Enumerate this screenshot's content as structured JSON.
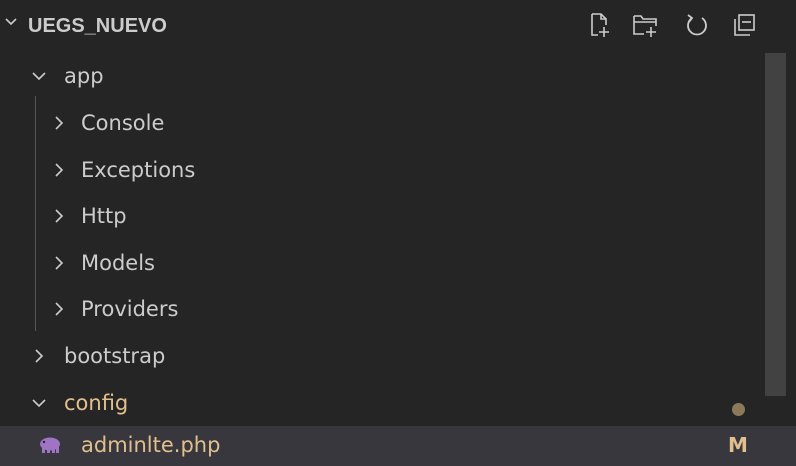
{
  "explorer": {
    "title": "UEGS_NUEVO",
    "actions": [
      {
        "icon": "new-file-icon"
      },
      {
        "icon": "new-folder-icon"
      },
      {
        "icon": "refresh-icon"
      },
      {
        "icon": "collapse-all-icon"
      }
    ],
    "tree": [
      {
        "label": "app",
        "type": "folder",
        "expanded": true,
        "depth": 0
      },
      {
        "label": "Console",
        "type": "folder",
        "expanded": false,
        "depth": 1
      },
      {
        "label": "Exceptions",
        "type": "folder",
        "expanded": false,
        "depth": 1
      },
      {
        "label": "Http",
        "type": "folder",
        "expanded": false,
        "depth": 1
      },
      {
        "label": "Models",
        "type": "folder",
        "expanded": false,
        "depth": 1
      },
      {
        "label": "Providers",
        "type": "folder",
        "expanded": false,
        "depth": 1
      },
      {
        "label": "bootstrap",
        "type": "folder",
        "expanded": false,
        "depth": 0
      },
      {
        "label": "config",
        "type": "folder",
        "expanded": true,
        "depth": 0,
        "modified_dot": true
      },
      {
        "label": "adminlte.php",
        "type": "file",
        "depth": 1,
        "icon": "php-elephant-icon",
        "git_status": "M",
        "selected": true
      }
    ]
  },
  "colors": {
    "background": "#252526",
    "text": "#cccccc",
    "modified": "#e2c08d",
    "selection": "#37373d",
    "scrollbar": "#424242"
  }
}
